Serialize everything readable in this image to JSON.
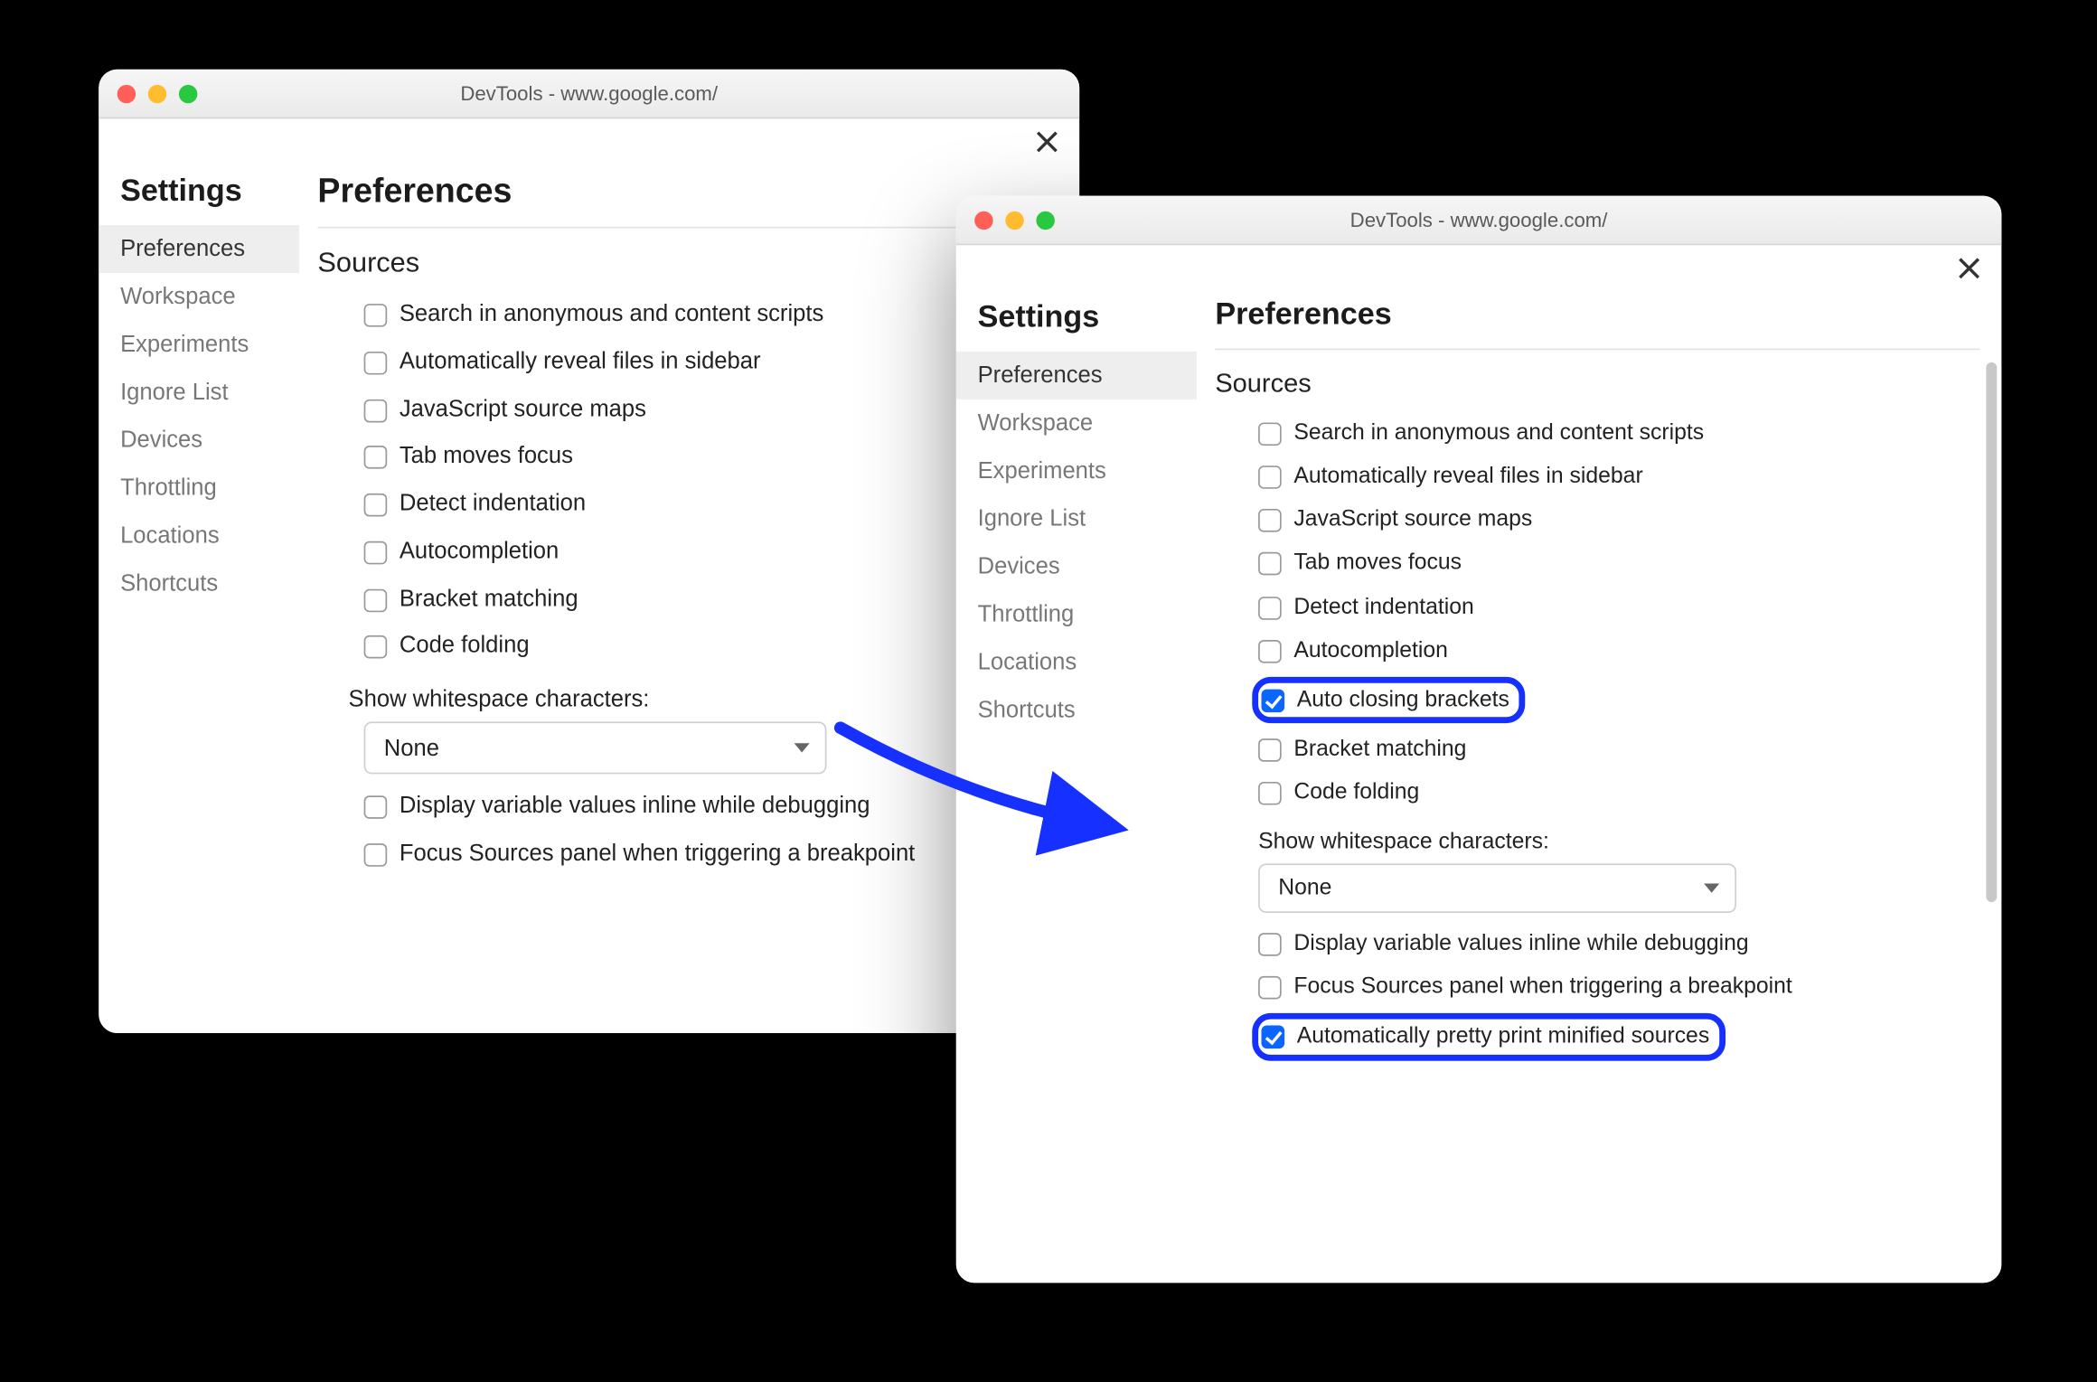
{
  "colors": {
    "highlight": "#1631ff",
    "accent": "#0a66ff"
  },
  "arrow_icon": "arrow-right",
  "windows": {
    "left": {
      "title": "DevTools - www.google.com/",
      "close_icon": "close-icon",
      "sidebar_title": "Settings",
      "nav": [
        "Preferences",
        "Workspace",
        "Experiments",
        "Ignore List",
        "Devices",
        "Throttling",
        "Locations",
        "Shortcuts"
      ],
      "nav_active_index": 0,
      "main_header": "Preferences",
      "section_title": "Sources",
      "options": [
        {
          "label": "Search in anonymous and content scripts",
          "checked": false
        },
        {
          "label": "Automatically reveal files in sidebar",
          "checked": false
        },
        {
          "label": "JavaScript source maps",
          "checked": false
        },
        {
          "label": "Tab moves focus",
          "checked": false
        },
        {
          "label": "Detect indentation",
          "checked": false
        },
        {
          "label": "Autocompletion",
          "checked": false
        },
        {
          "label": "Bracket matching",
          "checked": false
        },
        {
          "label": "Code folding",
          "checked": false
        }
      ],
      "whitespace_label": "Show whitespace characters:",
      "whitespace_value": "None",
      "options_after": [
        {
          "label": "Display variable values inline while debugging",
          "checked": false
        },
        {
          "label": "Focus Sources panel when triggering a breakpoint",
          "checked": false
        }
      ]
    },
    "right": {
      "title": "DevTools - www.google.com/",
      "close_icon": "close-icon",
      "sidebar_title": "Settings",
      "nav": [
        "Preferences",
        "Workspace",
        "Experiments",
        "Ignore List",
        "Devices",
        "Throttling",
        "Locations",
        "Shortcuts"
      ],
      "nav_active_index": 0,
      "main_header": "Preferences",
      "section_title": "Sources",
      "options_before_hl1": [
        {
          "label": "Search in anonymous and content scripts",
          "checked": false
        },
        {
          "label": "Automatically reveal files in sidebar",
          "checked": false
        },
        {
          "label": "JavaScript source maps",
          "checked": false
        },
        {
          "label": "Tab moves focus",
          "checked": false
        },
        {
          "label": "Detect indentation",
          "checked": false
        },
        {
          "label": "Autocompletion",
          "checked": false
        }
      ],
      "highlight1": {
        "label": "Auto closing brackets",
        "checked": true
      },
      "options_between": [
        {
          "label": "Bracket matching",
          "checked": false
        },
        {
          "label": "Code folding",
          "checked": false
        }
      ],
      "whitespace_label": "Show whitespace characters:",
      "whitespace_value": "None",
      "options_after": [
        {
          "label": "Display variable values inline while debugging",
          "checked": false
        },
        {
          "label": "Focus Sources panel when triggering a breakpoint",
          "checked": false
        }
      ],
      "highlight2": {
        "label": "Automatically pretty print minified sources",
        "checked": true
      }
    }
  }
}
